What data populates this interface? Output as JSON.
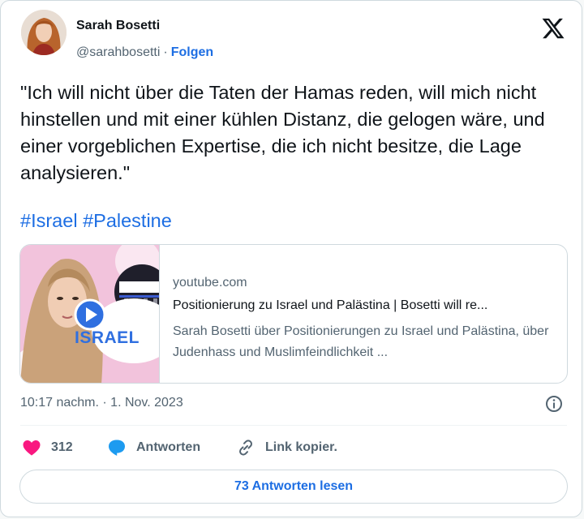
{
  "author": {
    "name": "Sarah Bosetti",
    "handle": "@sarahbosetti",
    "separator": "·",
    "follow_label": "Folgen"
  },
  "platform_logo": "x-logo-icon",
  "tweet": {
    "text": "\"Ich will nicht über die Taten der Hamas reden, will mich nicht hinstellen und mit einer kühlen Distanz, die gelogen wäre, und einer vorgeblichen Expertise, die ich nicht besitze, die Lage analysieren.\"",
    "hashtags": [
      "#Israel",
      "#Palestine"
    ]
  },
  "link_card": {
    "thumbnail_label": "ISRAEL",
    "domain": "youtube.com",
    "title": "Positionierung zu Israel und Palästina | Bosetti will re...",
    "description": "Sarah Bosetti über Positionierungen zu Israel und Palästina, über Judenhass und Muslimfeindlichkeit ..."
  },
  "timestamp": "10:17 nachm. · 1. Nov. 2023",
  "actions": {
    "like_count": "312",
    "reply_label": "Antworten",
    "copy_label": "Link kopier."
  },
  "read_replies_label": "73 Antworten lesen",
  "colors": {
    "accent": "#1d6ee3",
    "like": "#f91880",
    "reply": "#1d9bf0",
    "text": "#0f1419",
    "muted": "#536471",
    "border": "#cfd9de"
  }
}
